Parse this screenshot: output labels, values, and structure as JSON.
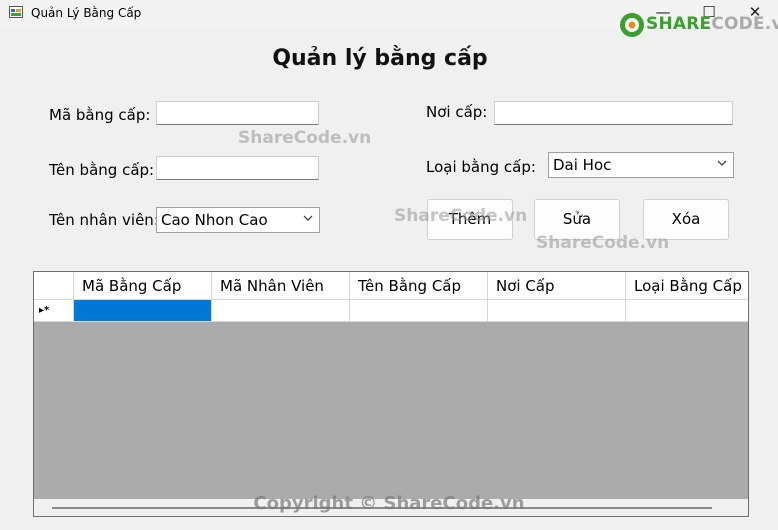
{
  "window": {
    "title": "Quản Lý Bằng Cấp",
    "minimize_glyph": "—",
    "maximize_glyph": "☐",
    "close_glyph": "✕"
  },
  "logo": {
    "prefix": "SHARE",
    "suffix": "CODE",
    "tld": ".vn"
  },
  "form": {
    "heading": "Quản lý bằng cấp",
    "ma_bang_cap": {
      "label": "Mã bằng cấp:",
      "value": ""
    },
    "ten_bang_cap": {
      "label": "Tên bằng cấp:",
      "value": ""
    },
    "ten_nhan_vien": {
      "label": "Tên nhân viên:",
      "value": "Cao Nhon Cao"
    },
    "noi_cap": {
      "label": "Nơi cấp:",
      "value": ""
    },
    "loai_bang_cap": {
      "label": "Loại bằng cấp:",
      "value": "Dai Hoc"
    }
  },
  "buttons": {
    "them": "Thêm",
    "sua": "Sửa",
    "xoa": "Xóa"
  },
  "watermarks": [
    "ShareCode.vn",
    "ShareCode.vn",
    "ShareCode.vn"
  ],
  "grid": {
    "columns": [
      "Mã Bằng Cấp",
      "Mã Nhân Viên",
      "Tên Bằng Cấp",
      "Nơi Cấp",
      "Loại Bằng Cấp"
    ],
    "new_row_marker": "▸*"
  },
  "copyright": "Copyright © ShareCode.vn",
  "colors": {
    "selection": "#0078d7",
    "grid_background": "#ababab",
    "logo_green": "#3aa02e"
  },
  "icons": [
    "app-icon",
    "chevron-down-icon",
    "sharecode-logo-icon"
  ]
}
